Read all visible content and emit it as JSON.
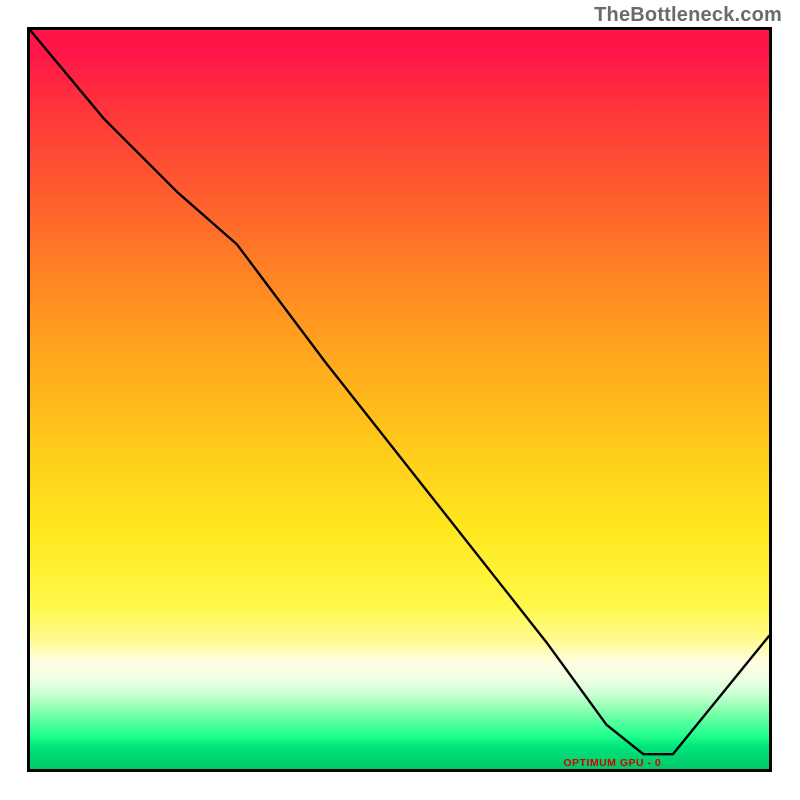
{
  "watermark": "TheBottleneck.com",
  "min_label": "OPTIMUM GPU - 0",
  "chart_data": {
    "type": "line",
    "title": "",
    "xlabel": "",
    "ylabel": "",
    "note": "Axes are unlabeled in the source image; x/y are normalized 0–100 within the plotting frame. The curve depicts bottleneck% (y, 100=top) vs GPU tier (x). Background vertical gradient encodes goodness: red (high bottleneck) at top → yellow → green (optimal) at bottom.",
    "xlim": [
      0,
      100
    ],
    "ylim": [
      0,
      100
    ],
    "series": [
      {
        "name": "bottleneck-curve",
        "x": [
          0,
          10,
          20,
          28,
          40,
          55,
          70,
          78,
          83,
          87,
          100
        ],
        "y": [
          100,
          88,
          78,
          71,
          55,
          36,
          17,
          6,
          2,
          2,
          18
        ]
      }
    ],
    "optimum_marker": {
      "x": 83,
      "y": 2,
      "label": "OPTIMUM GPU - 0"
    },
    "gradient_stops": [
      {
        "pct": 0,
        "color": "#ff1547"
      },
      {
        "pct": 26,
        "color": "#ff6a2a"
      },
      {
        "pct": 55,
        "color": "#ffc71a"
      },
      {
        "pct": 78,
        "color": "#fff94a"
      },
      {
        "pct": 88,
        "color": "#ecffe3"
      },
      {
        "pct": 95,
        "color": "#21ff8d"
      },
      {
        "pct": 100,
        "color": "#00c869"
      }
    ]
  }
}
